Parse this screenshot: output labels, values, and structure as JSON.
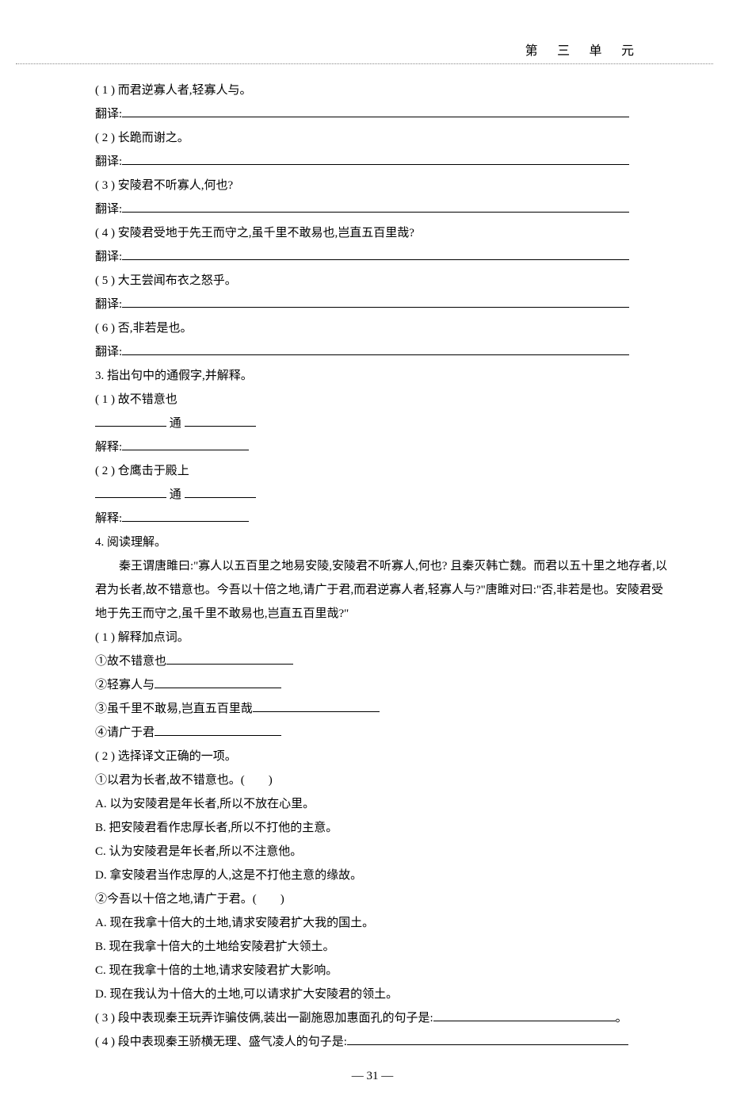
{
  "header": {
    "unit": "第 三 单 元"
  },
  "q_sentences": {
    "s1": "( 1 ) 而君逆寡人者,轻寡人与。",
    "s2": "( 2 ) 长跪而谢之。",
    "s3": "( 3 ) 安陵君不听寡人,何也?",
    "s4": "( 4 ) 安陵君受地于先王而守之,虽千里不敢易也,岂直五百里哉?",
    "s5": "( 5 ) 大王尝闻布衣之怒乎。",
    "s6": "( 6 ) 否,非若是也。",
    "trans_label": "翻译:"
  },
  "q3": {
    "title": "3. 指出句中的通假字,并解释。",
    "a_text": "( 1 ) 故不错意也",
    "b_text": "( 2 ) 仓鹰击于殿上",
    "tong": "通",
    "explain": "解释:"
  },
  "q4": {
    "title": "4. 阅读理解。",
    "passage": "秦王谓唐雎曰:\"寡人以五百里之地易安陵,安陵君不听寡人,何也? 且秦灭韩亡魏。而君以五十里之地存者,以君为长者,故不错意也。今吾以十倍之地,请广于君,而君逆寡人者,轻寡人与?\"唐雎对曰:\"否,非若是也。安陵君受地于先王而守之,虽千里不敢易也,岂直五百里哉?\"",
    "p1_title": "( 1 ) 解释加点词。",
    "p1_items": {
      "i1": "①故不错意也",
      "i2": "②轻寡人与",
      "i3": "③虽千里不敢易,岂直五百里哉",
      "i4": "④请广于君"
    },
    "p2_title": "( 2 ) 选择译文正确的一项。",
    "p2_q1": "①以君为长者,故不错意也。(　　)",
    "p2_q1_opts": {
      "A": "A. 以为安陵君是年长者,所以不放在心里。",
      "B": "B. 把安陵君看作忠厚长者,所以不打他的主意。",
      "C": "C. 认为安陵君是年长者,所以不注意他。",
      "D": "D. 拿安陵君当作忠厚的人,这是不打他主意的缘故。"
    },
    "p2_q2": "②今吾以十倍之地,请广于君。(　　)",
    "p2_q2_opts": {
      "A": "A. 现在我拿十倍大的土地,请求安陵君扩大我的国土。",
      "B": "B. 现在我拿十倍大的土地给安陵君扩大领土。",
      "C": "C. 现在我拿十倍的土地,请求安陵君扩大影响。",
      "D": "D. 现在我认为十倍大的土地,可以请求扩大安陵君的领土。"
    },
    "p3": "( 3 ) 段中表现秦王玩弄诈骗伎俩,装出一副施恩加惠面孔的句子是:",
    "p3_end": "。",
    "p4": "( 4 ) 段中表现秦王骄横无理、盛气凌人的句子是:"
  },
  "footer": {
    "page": "— 31 —"
  }
}
